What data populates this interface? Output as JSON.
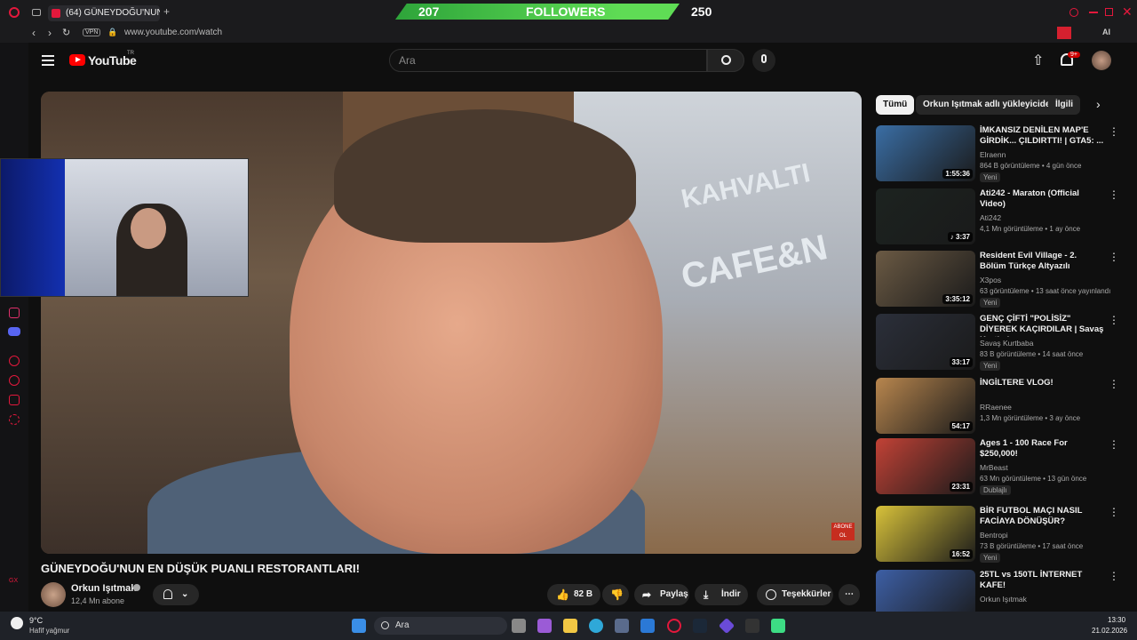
{
  "browser": {
    "tab_title": "(64) GÜNEYDOĞU'NUN",
    "url": "www.youtube.com/watch",
    "vpn_label": "VPN",
    "ai_label": "AI"
  },
  "stream_overlay": {
    "left_count": "207",
    "label": "FOLLOWERS",
    "right_count": "250"
  },
  "youtube": {
    "logo_text": "YouTube",
    "logo_region": "TR",
    "search_placeholder": "Ara",
    "notification_count": "9+"
  },
  "video": {
    "title": "GÜNEYDOĞU'NUN EN DÜŞÜK PUANLI RESTORANTLARI!",
    "channel": "Orkun Işıtmak",
    "subscribers": "12,4 Mn abone",
    "likes": "82 B",
    "share_label": "Paylaş",
    "download_label": "İndir",
    "thanks_label": "Teşekkürler",
    "overlay_text_1": "KAHVALTI",
    "overlay_text_2": "CAFE&N",
    "subscribe_badge": "ABONE OL"
  },
  "chips": [
    "Tümü",
    "Orkun Işıtmak adlı yükleyiciden",
    "İlgili"
  ],
  "recommendations": [
    {
      "title": "İMKANSIZ DENİLEN MAP'E GİRDİK... ÇILDIRTTI! | GTA5: ...",
      "channel": "Elraenn",
      "meta": "864 B görüntüleme • 4 gün önce",
      "duration": "1:55:36",
      "badge": "Yeni",
      "color": "#3a6ea5"
    },
    {
      "title": "Ati242 - Maraton (Official Video)",
      "channel": "Ati242",
      "meta": "4,1 Mn görüntüleme • 1 ay önce",
      "duration": "♪ 3:37",
      "badge": "",
      "color": "#1c2320"
    },
    {
      "title": "Resident Evil Village - 2. Bölüm Türkçe Altyazılı",
      "channel": "X3pos",
      "meta": "63 görüntüleme • 13 saat önce yayınlandı",
      "duration": "3:35:12",
      "badge": "Yeni",
      "color": "#6b5a44"
    },
    {
      "title": "GENÇ ÇİFTİ \"POLİSİZ\" DİYEREK KAÇIRDILAR | Savaş Kurtbaba ...",
      "channel": "Savaş Kurtbaba",
      "meta": "83 B görüntüleme • 14 saat önce",
      "duration": "33:17",
      "badge": "Yeni",
      "color": "#2b2f3a"
    },
    {
      "title": "İNGİLTERE VLOG!",
      "channel": "RRaenee",
      "meta": "1,3 Mn görüntüleme • 3 ay önce",
      "duration": "54:17",
      "badge": "",
      "color": "#b8864e"
    },
    {
      "title": "Ages 1 - 100 Race For $250,000!",
      "channel": "MrBeast",
      "meta": "63 Mn görüntüleme • 13 gün önce",
      "duration": "23:31",
      "badge": "Dublajlı",
      "color": "#c24236"
    },
    {
      "title": "BİR FUTBOL MAÇI NASIL FACİAYA DÖNÜŞÜR?",
      "channel": "Bentropi",
      "meta": "73 B görüntüleme • 17 saat önce",
      "duration": "16:52",
      "badge": "Yeni",
      "color": "#d8c23a"
    },
    {
      "title": "25TL vs 150TL İNTERNET KAFE!",
      "channel": "Orkun Işıtmak",
      "meta": "",
      "duration": "",
      "badge": "",
      "color": "#3d5fa5"
    }
  ],
  "taskbar": {
    "weather_temp": "9°C",
    "weather_desc": "Hafif yağmur",
    "search_label": "Ara",
    "time": "13:30",
    "date": "21.02.2026"
  },
  "sidebar_badge": "GX"
}
